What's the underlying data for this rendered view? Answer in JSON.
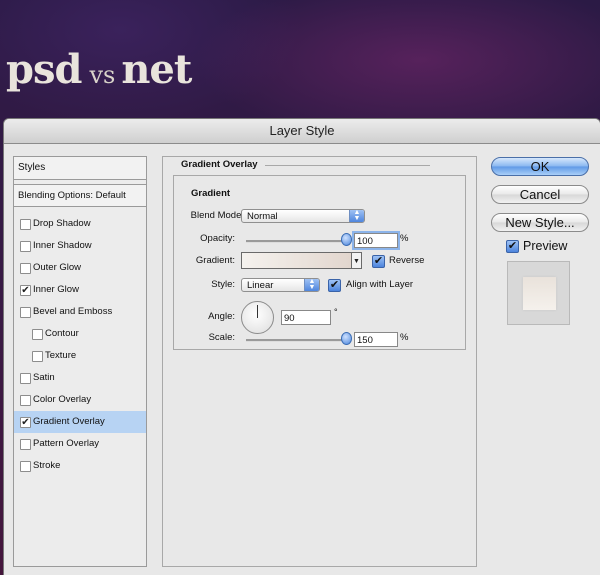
{
  "banner": {
    "logo_left": "psd",
    "logo_mid": "vs",
    "logo_right": "net"
  },
  "window": {
    "title": "Layer Style"
  },
  "styles_list": {
    "header": "Styles",
    "blending": "Blending Options: Default",
    "items": [
      {
        "label": "Drop Shadow",
        "checked": false
      },
      {
        "label": "Inner Shadow",
        "checked": false
      },
      {
        "label": "Outer Glow",
        "checked": false
      },
      {
        "label": "Inner Glow",
        "checked": true
      },
      {
        "label": "Bevel and Emboss",
        "checked": false
      },
      {
        "label": "Contour",
        "checked": false
      },
      {
        "label": "Texture",
        "checked": false
      },
      {
        "label": "Satin",
        "checked": false
      },
      {
        "label": "Color Overlay",
        "checked": false
      },
      {
        "label": "Gradient Overlay",
        "checked": true,
        "selected": true
      },
      {
        "label": "Pattern Overlay",
        "checked": false
      },
      {
        "label": "Stroke",
        "checked": false
      }
    ]
  },
  "gradient_overlay": {
    "title": "Gradient Overlay",
    "group_title": "Gradient",
    "blend_mode_label": "Blend Mode:",
    "blend_mode_value": "Normal",
    "opacity_label": "Opacity:",
    "opacity_value": "100",
    "opacity_unit": "%",
    "opacity_fraction": 1.0,
    "gradient_label": "Gradient:",
    "reverse_label": "Reverse",
    "reverse_checked": true,
    "style_label": "Style:",
    "style_value": "Linear",
    "align_label": "Align with Layer",
    "align_checked": true,
    "angle_label": "Angle:",
    "angle_value": "90",
    "angle_unit": "°",
    "scale_label": "Scale:",
    "scale_value": "150",
    "scale_unit": "%",
    "scale_fraction": 1.0,
    "gradient_colors": [
      "#f5f2ee",
      "#e2d6ce"
    ]
  },
  "buttons": {
    "ok": "OK",
    "cancel": "Cancel",
    "new_style": "New Style...",
    "preview_label": "Preview",
    "preview_checked": true
  },
  "colors": {
    "selection": "#b7d3f3",
    "accent": "#4c84dc"
  }
}
